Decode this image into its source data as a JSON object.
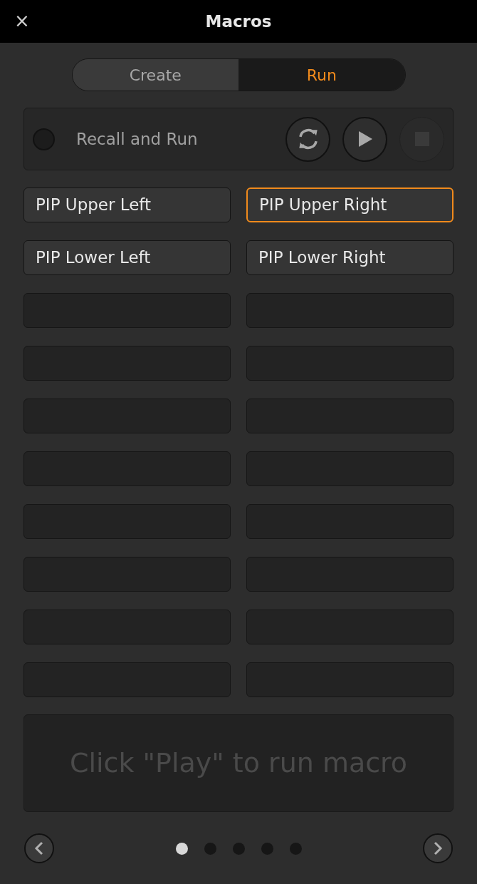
{
  "window": {
    "title": "Macros",
    "close": "×"
  },
  "tabs": [
    {
      "label": "Create",
      "selected": false
    },
    {
      "label": "Run",
      "selected": true
    }
  ],
  "recall": {
    "label": "Recall and Run",
    "checked": false,
    "loop": {
      "disabled": false
    },
    "play": {
      "disabled": false
    },
    "stop": {
      "disabled": true
    }
  },
  "slots": [
    {
      "kind": "macro",
      "label": "PIP Upper Left",
      "selected": false
    },
    {
      "kind": "macro",
      "label": "PIP Upper Right",
      "selected": true
    },
    {
      "kind": "macro",
      "label": "PIP Lower Left",
      "selected": false
    },
    {
      "kind": "macro",
      "label": "PIP Lower Right",
      "selected": false
    },
    {
      "kind": "empty",
      "selected": false
    },
    {
      "kind": "empty",
      "selected": false
    },
    {
      "kind": "empty",
      "selected": false
    },
    {
      "kind": "empty",
      "selected": false
    },
    {
      "kind": "empty",
      "selected": false
    },
    {
      "kind": "empty",
      "selected": false
    },
    {
      "kind": "empty",
      "selected": false
    },
    {
      "kind": "empty",
      "selected": false
    },
    {
      "kind": "empty",
      "selected": false
    },
    {
      "kind": "empty",
      "selected": false
    },
    {
      "kind": "empty",
      "selected": false
    },
    {
      "kind": "empty",
      "selected": false
    },
    {
      "kind": "empty",
      "selected": false
    },
    {
      "kind": "empty",
      "selected": false
    },
    {
      "kind": "empty",
      "selected": false
    },
    {
      "kind": "empty",
      "selected": false
    }
  ],
  "message": "Click \"Play\" to run macro",
  "pages": [
    {
      "selected": true
    },
    {
      "selected": false
    },
    {
      "selected": false
    },
    {
      "selected": false
    },
    {
      "selected": false
    }
  ]
}
